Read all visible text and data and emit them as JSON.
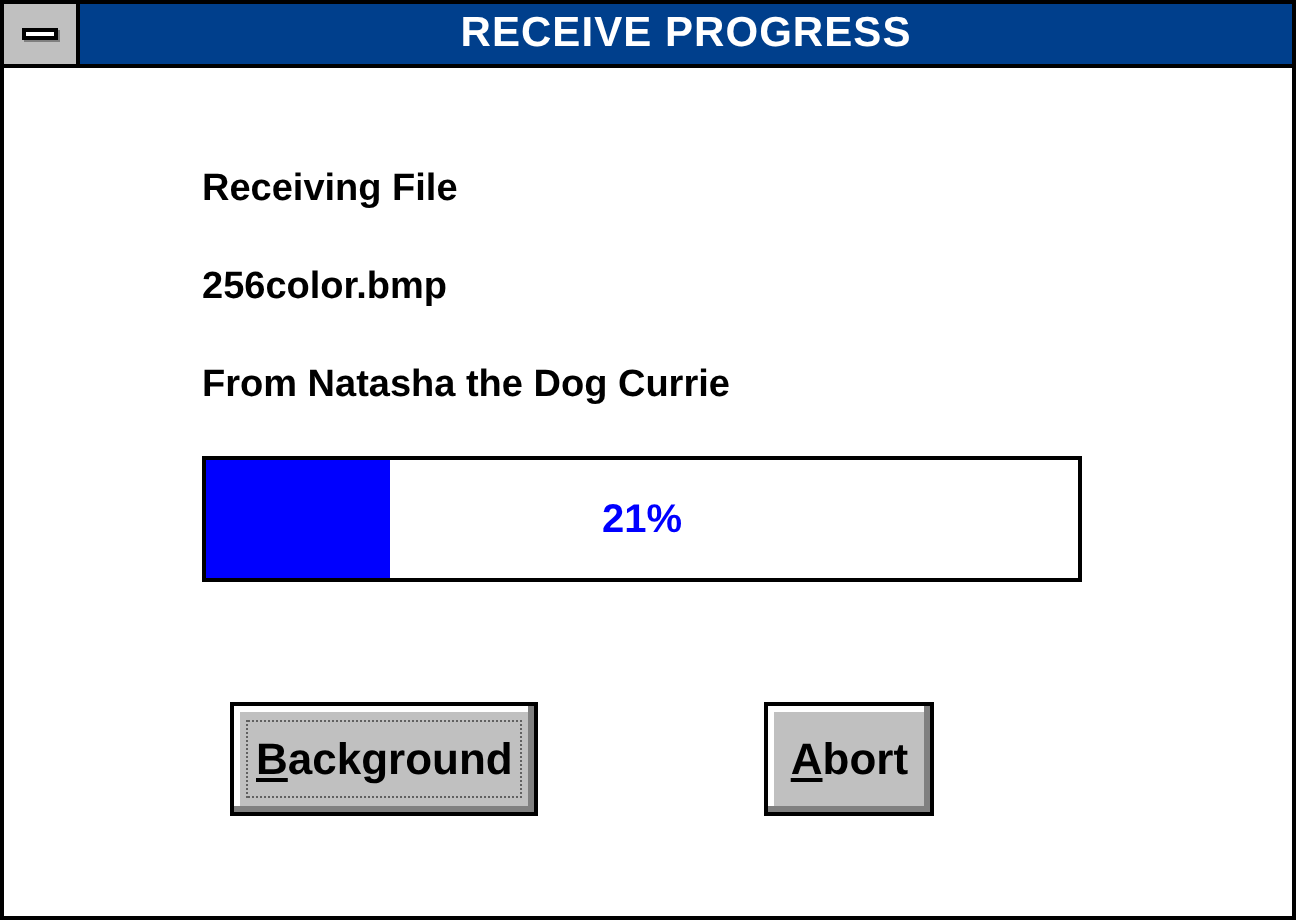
{
  "window": {
    "title": "RECEIVE PROGRESS"
  },
  "lines": [
    "Receiving File",
    "256color.bmp",
    "From Natasha the Dog Currie"
  ],
  "progress": {
    "level": 0.21,
    "reading": "21%"
  },
  "buttons": [
    {
      "mnemonic": "B",
      "rest": "ackground",
      "focused": true
    },
    {
      "mnemonic": "A",
      "rest": "bort",
      "focused": false
    }
  ]
}
